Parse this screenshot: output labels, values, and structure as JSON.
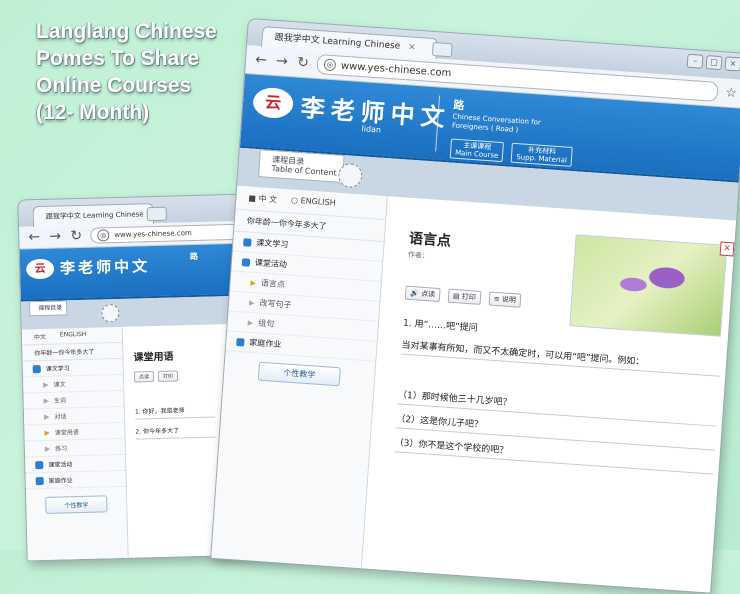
{
  "promo": {
    "line1": "Langlang Chinese",
    "line2": "Pomes To Share",
    "line3": "Online Courses",
    "line4": "(12- Month)"
  },
  "front": {
    "tab_title": "跟我学中文 Learning Chinese",
    "tab_close": "×",
    "url": "www.yes-chinese.com",
    "brand": "李老师中文",
    "brand_sub": "lidan",
    "logo": "云",
    "course_title": "路",
    "course_sub": "Chinese Conversation for Foreigners ( Road )",
    "menu": [
      {
        "label": "主课课程\nMain Course"
      },
      {
        "label": "补充材料\nSupp. Material"
      }
    ],
    "contents_label": "课程目录\nTable of Content",
    "lang": {
      "zh": "中 文",
      "en": "ENGLISH"
    },
    "lesson_intro": "你年龄一你今年多大了",
    "sidebar": [
      {
        "label": "课文学习",
        "type": "main"
      },
      {
        "label": "课堂活动",
        "type": "main"
      },
      {
        "label": "语言点",
        "type": "sub",
        "active": true
      },
      {
        "label": "改写句子",
        "type": "sub",
        "active": false
      },
      {
        "label": "组句",
        "type": "sub",
        "active": false
      },
      {
        "label": "家庭作业",
        "type": "main"
      }
    ],
    "assist_button": "个性教学",
    "lesson_title": "语言点",
    "author": "作者：",
    "controls": [
      "点读",
      "打印",
      "说明"
    ],
    "point": "1. 用“……吧”提问",
    "para": "当对某事有所知，而又不太确定时，可以用“吧”提问。例如：",
    "examples": [
      "（1）那时候他三十几岁吧？",
      "（2）这是你儿子吧？",
      "（3）你不是这个学校的吧？"
    ]
  },
  "back": {
    "tab_title": "跟我学中文 Learning Chinese",
    "url": "www.yes-chinese.com",
    "brand": "李老师中文",
    "logo": "云",
    "course_title": "路",
    "contents_label": "课程目录",
    "lang": {
      "zh": "中文",
      "en": "ENGLISH"
    },
    "lesson_intro": "你年龄一你今年多大了",
    "sidebar": [
      {
        "label": "课文学习",
        "type": "main"
      },
      {
        "label": "课文",
        "type": "sub"
      },
      {
        "label": "生词",
        "type": "sub"
      },
      {
        "label": "对话",
        "type": "sub"
      },
      {
        "label": "课堂用语",
        "type": "sub"
      },
      {
        "label": "练习",
        "type": "sub"
      },
      {
        "label": "课堂活动",
        "type": "main"
      },
      {
        "label": "家庭作业",
        "type": "main"
      }
    ],
    "assist_button": "个性教学",
    "lesson_title": "课堂用语",
    "controls": [
      "点读",
      "打印"
    ],
    "examples": [
      "1. 你好，我是老师",
      "2. 你今年多大了"
    ]
  }
}
